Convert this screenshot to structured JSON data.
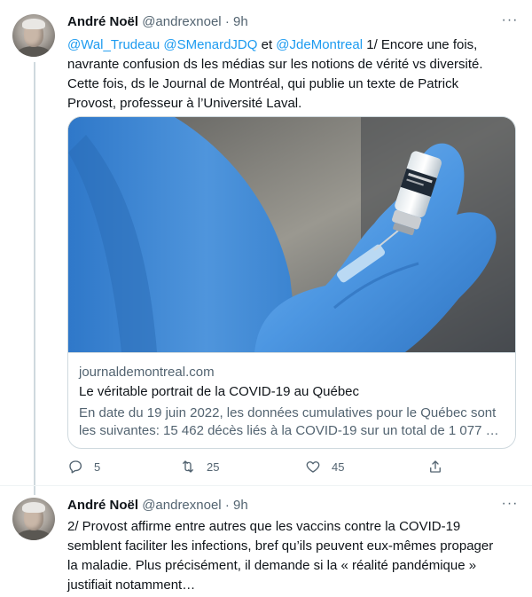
{
  "tweets": [
    {
      "author_name": "André Noël",
      "handle": "@andrexnoel",
      "separator": "·",
      "time": "9h",
      "more": "···",
      "mentions": [
        "@Wal_Trudeau",
        "@SMenardJDQ",
        "@JdeMontreal"
      ],
      "connector": "et",
      "text_line1_rest": "1/ Encore une fois,",
      "text_lines": [
        "navrante confusion ds les médias sur les notions de vérité vs diversité.",
        "Cette fois, ds le Journal de Montréal, qui publie un texte de Patrick",
        "Provost, professeur à l’Université Laval."
      ],
      "card": {
        "domain": "journaldemontreal.com",
        "title": "Le véritable portrait de la COVID-19 au Québec",
        "description_line1": "En date du 19 juin 2022, les données cumulatives pour le Québec sont",
        "description_line2": "les suivantes: 15 462 décès liés à la COVID-19 sur un total de 1 077 …"
      },
      "actions": {
        "replies": "5",
        "retweets": "25",
        "likes": "45"
      },
      "icons": [
        "reply-icon",
        "retweet-icon",
        "like-icon",
        "share-icon",
        "more-icon"
      ]
    },
    {
      "author_name": "André Noël",
      "handle": "@andrexnoel",
      "separator": "·",
      "time": "9h",
      "more": "···",
      "text_lines": [
        "2/ Provost affirme entre autres que les vaccins contre la COVID-19",
        "semblent faciliter les infections, bref qu’ils peuvent eux-mêmes propager",
        "la maladie. Plus précisément, il demande si la « réalité pandémique »",
        "justifiait notamment…"
      ]
    }
  ],
  "colors": {
    "link": "#1d9bf0",
    "text": "#0f1419",
    "secondary": "#536471",
    "border": "#cfd9de",
    "glove": "#3b8fe0"
  }
}
